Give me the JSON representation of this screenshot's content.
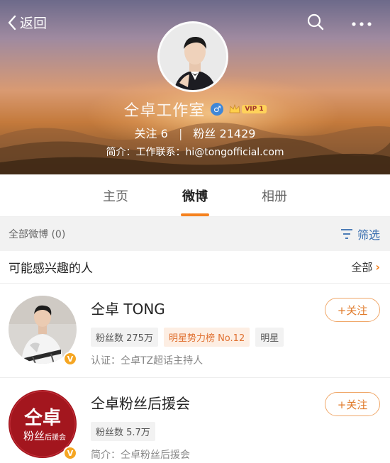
{
  "header": {
    "back_label": "返回",
    "profile_name": "仝卓工作室",
    "gender_symbol": "♂",
    "vip_label": "VIP",
    "vip_level": "1",
    "following_label": "关注",
    "following_count": "6",
    "followers_label": "粉丝",
    "followers_count": "21429",
    "intro": "简介：工作联系：hi@tongofficial.com"
  },
  "tabs": [
    {
      "label": "主页",
      "active": false
    },
    {
      "label": "微博",
      "active": true
    },
    {
      "label": "相册",
      "active": false
    }
  ],
  "filter_bar": {
    "count_label": "全部微博 (0)",
    "filter_label": "筛选"
  },
  "suggestions": {
    "title": "可能感兴趣的人",
    "all_label": "全部",
    "people": [
      {
        "name": "仝卓 TONG",
        "tags": [
          "粉丝数 275万",
          "明星势力榜 No.12",
          "明星"
        ],
        "desc": "认证：仝卓TZ超话主持人",
        "follow_label": "+关注",
        "badge": "V"
      },
      {
        "name": "仝卓粉丝后援会",
        "tags": [
          "粉丝数 5.7万"
        ],
        "desc": "简介：仝卓粉丝后援会",
        "follow_label": "+关注",
        "badge": "V",
        "logo_main": "仝卓",
        "logo_sub": "粉丝",
        "logo_small": "后援会"
      }
    ]
  },
  "colors": {
    "accent": "#f5821f",
    "link_blue": "#3a6fb0",
    "tag_hot": "#e07030"
  }
}
